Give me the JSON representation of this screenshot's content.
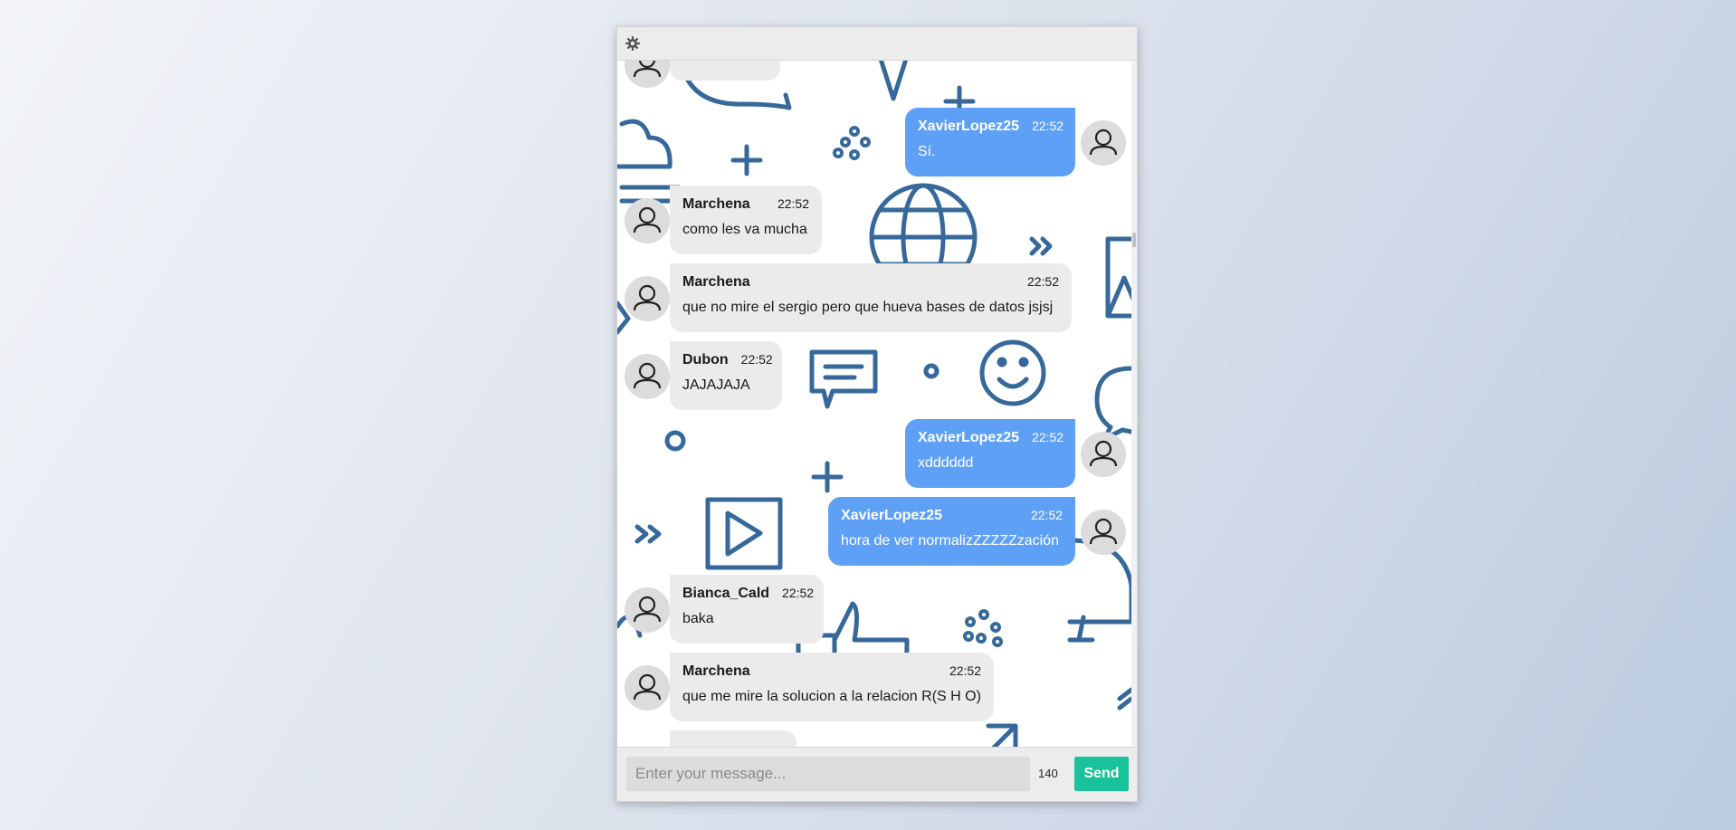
{
  "header": {
    "settings_icon": "gear-icon"
  },
  "colors": {
    "mine_bubble": "#5fa0f7",
    "other_bubble": "#ebebeb",
    "send_button": "#19c29a",
    "pattern": "#36699a"
  },
  "messages": [
    {
      "author": "XavierLopez25",
      "time": "22:52",
      "text": "Sí.",
      "mine": true
    },
    {
      "author": "Marchena",
      "time": "22:52",
      "text": "como les va mucha",
      "mine": false
    },
    {
      "author": "Marchena",
      "time": "22:52",
      "text": "que no mire el sergio pero que hueva bases de datos jsjsj",
      "mine": false
    },
    {
      "author": "Dubon",
      "time": "22:52",
      "text": "JAJAJAJA",
      "mine": false
    },
    {
      "author": "XavierLopez25",
      "time": "22:52",
      "text": "xdddddd",
      "mine": true
    },
    {
      "author": "XavierLopez25",
      "time": "22:52",
      "text": "hora de ver normalizZZZZZzación",
      "mine": true
    },
    {
      "author": "Bianca_Cald",
      "time": "22:52",
      "text": "baka",
      "mine": false
    },
    {
      "author": "Marchena",
      "time": "22:52",
      "text": "que me mire la solucion a la relacion R(S H O)",
      "mine": false
    }
  ],
  "composer": {
    "placeholder": "Enter your message...",
    "counter": "140",
    "send_label": "Send"
  }
}
